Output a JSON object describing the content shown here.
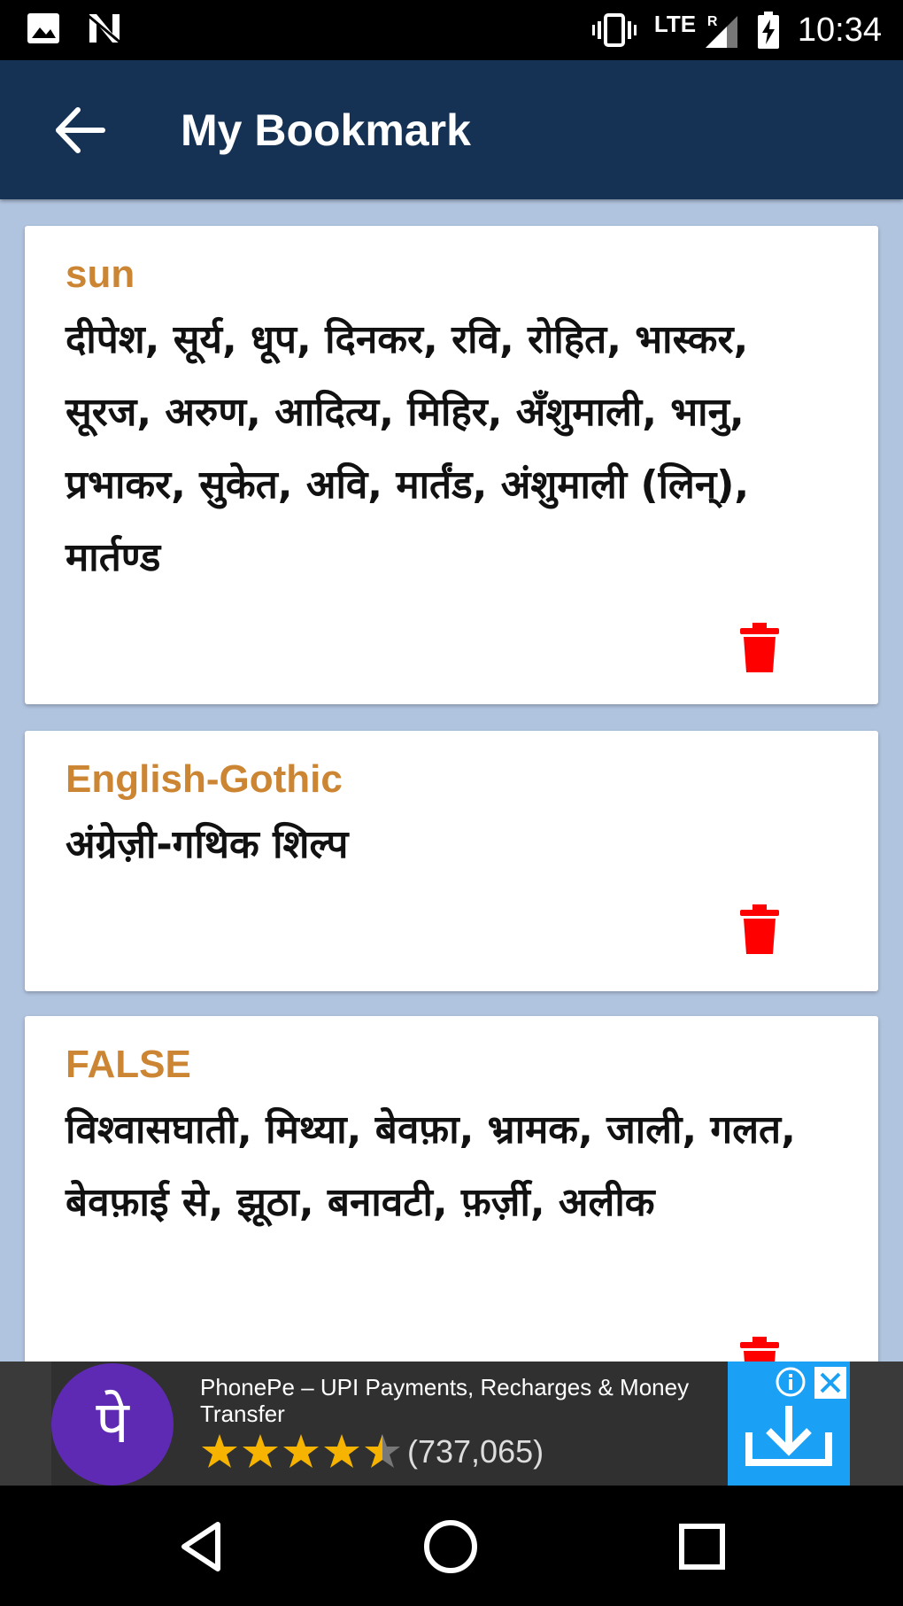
{
  "status_bar": {
    "time": "10:34",
    "network": "LTE",
    "roaming": "R",
    "icons": [
      "image-icon",
      "no-signal-n-icon",
      "vibrate-icon",
      "signal-icon",
      "battery-charging-icon"
    ]
  },
  "app_bar": {
    "title": "My Bookmark",
    "back_icon": "arrow-back-icon",
    "background": "#153255"
  },
  "bookmarks": [
    {
      "word": "sun",
      "meaning": "दीपेश, सूर्य, धूप, दिनकर, रवि, रोहित, भास्कर, सूरज, अरुण, आदित्य, मिहिर, अँशुमाली, भानु, प्रभाकर, सुकेत, अवि, मार्तंड, अंशुमाली (लिन्), मार्तण्ड",
      "delete_icon": "trash-icon"
    },
    {
      "word": "English-Gothic",
      "meaning": "अंग्रेज़ी-गथिक शिल्प",
      "delete_icon": "trash-icon"
    },
    {
      "word": "FALSE",
      "meaning": "विश्वासघाती, मिथ्या, बेवफ़ा, भ्रामक, जाली, गलत, बेवफ़ाई से, झूठा, बनावटी, फ़र्ज़ी, अलीक",
      "delete_icon": "trash-icon"
    }
  ],
  "ad": {
    "logo_text": "पे",
    "title": "PhonePe – UPI Payments, Recharges & Money Transfer",
    "rating": 4.5,
    "rating_count": "(737,065)",
    "install_icon": "download-icon",
    "info_icon": "info-icon",
    "close_icon": "close-icon"
  },
  "nav_bar": {
    "buttons": [
      "back-triangle-icon",
      "home-circle-icon",
      "recents-square-icon"
    ]
  },
  "colors": {
    "accent_word": "#cc8633",
    "delete": "#ff0000",
    "page_bg": "#b1c4df"
  }
}
